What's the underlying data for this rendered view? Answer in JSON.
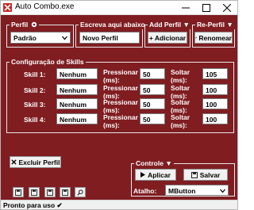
{
  "window": {
    "title": "Auto Combo.exe"
  },
  "perfil": {
    "title": "Perfil",
    "selected": "Padrão"
  },
  "escreva": {
    "title": "Escreva aqui abaixo",
    "value": "Novo Perfil"
  },
  "add_perfil": {
    "title": "Add Perfil",
    "button": "+ Adicionar"
  },
  "re_perfil": {
    "title": "Re-Perfil",
    "button": "Renomear"
  },
  "skills_group": {
    "title": "Configuração de Skills"
  },
  "skills": [
    {
      "label": "Skill 1:",
      "key": "Nenhum",
      "press_label": [
        "Pressionar",
        "(ms):"
      ],
      "press": "50",
      "release_label": [
        "Soltar",
        "(ms):"
      ],
      "release": "105"
    },
    {
      "label": "Skill 2:",
      "key": "Nenhum",
      "press_label": [
        "Pressionar",
        "(ms):"
      ],
      "press": "50",
      "release_label": [
        "Soltar",
        "(ms):"
      ],
      "release": "100"
    },
    {
      "label": "Skill 3:",
      "key": "Nenhum",
      "press_label": [
        "Pressionar",
        "(ms):"
      ],
      "press": "50",
      "release_label": [
        "Soltar",
        "(ms):"
      ],
      "release": "100"
    },
    {
      "label": "Skill 4:",
      "key": "Nenhum",
      "press_label": [
        "Pressionar",
        "(ms):"
      ],
      "press": "50",
      "release_label": [
        "Soltar",
        "(ms):"
      ],
      "release": "100"
    }
  ],
  "excluir": {
    "button": "Excluir Perfil"
  },
  "controle": {
    "title": "Controle",
    "apply": "Aplicar",
    "save": "Salvar",
    "atalho_label": "Atalho:",
    "atalho_value": "MButton"
  },
  "status": {
    "text": "Pronto para uso ✔"
  },
  "icons": [
    "app-icon",
    "minimize-icon",
    "maximize-icon",
    "close-icon",
    "gear-icon",
    "chevron-down-icon",
    "pencil-icon",
    "close-x-icon",
    "play-icon",
    "floppy-icon",
    "folder-icon",
    "magnifier-icon"
  ]
}
